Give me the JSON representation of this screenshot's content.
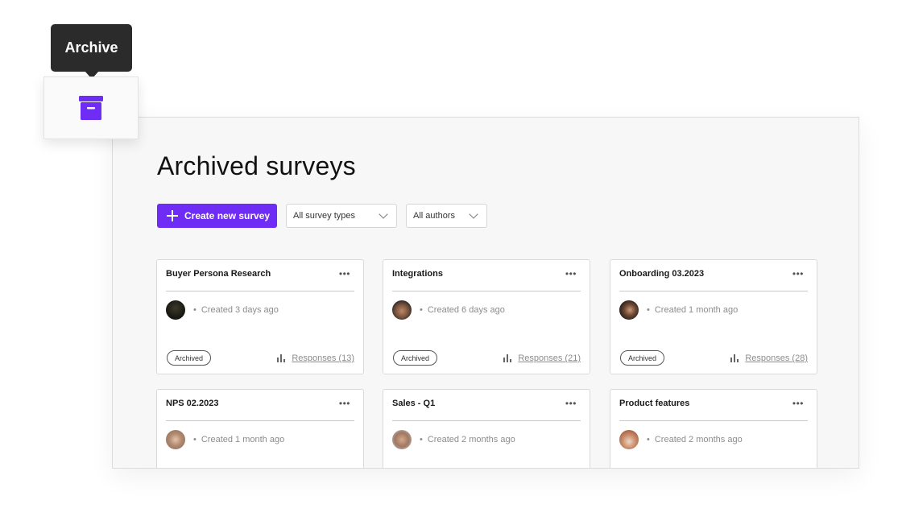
{
  "tooltip": {
    "text": "Archive"
  },
  "archive_icon": {
    "name": "archive-box-icon",
    "color": "#6e2cf4"
  },
  "page": {
    "title": "Archived surveys"
  },
  "toolbar": {
    "create_label": "Create new survey",
    "type_filter": "All survey types",
    "author_filter": "All authors",
    "accent": "#6e2cf4"
  },
  "cards": [
    {
      "title": "Buyer Persona Research",
      "created": "Created 3 days ago",
      "badge": "Archived",
      "responses": "Responses (13)"
    },
    {
      "title": "Integrations",
      "created": "Created 6 days ago",
      "badge": "Archived",
      "responses": "Responses (21)"
    },
    {
      "title": "Onboarding 03.2023",
      "created": "Created 1 month ago",
      "badge": "Archived",
      "responses": "Responses (28)"
    },
    {
      "title": "NPS 02.2023",
      "created": "Created 1 month ago"
    },
    {
      "title": "Sales - Q1",
      "created": "Created 2 months ago"
    },
    {
      "title": "Product features",
      "created": "Created 2 months ago"
    }
  ]
}
